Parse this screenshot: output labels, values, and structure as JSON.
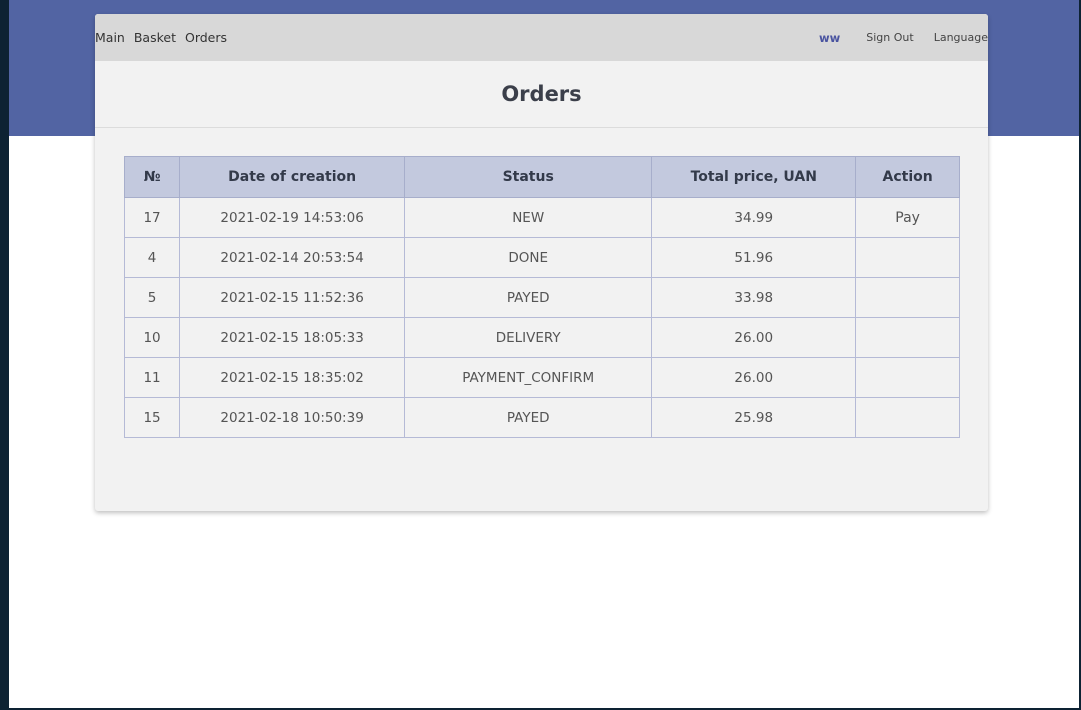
{
  "nav": {
    "main": "Main",
    "basket": "Basket",
    "orders": "Orders",
    "user": "ww",
    "sign_out": "Sign Out",
    "language": "Language"
  },
  "page_title": "Orders",
  "table": {
    "headers": [
      "№",
      "Date of creation",
      "Status",
      "Total price, UAN",
      "Action"
    ],
    "rows": [
      {
        "id": "17",
        "date": "2021-02-19 14:53:06",
        "status": "NEW",
        "price": "34.99",
        "action": "Pay"
      },
      {
        "id": "4",
        "date": "2021-02-14 20:53:54",
        "status": "DONE",
        "price": "51.96",
        "action": ""
      },
      {
        "id": "5",
        "date": "2021-02-15 11:52:36",
        "status": "PAYED",
        "price": "33.98",
        "action": ""
      },
      {
        "id": "10",
        "date": "2021-02-15 18:05:33",
        "status": "DELIVERY",
        "price": "26.00",
        "action": ""
      },
      {
        "id": "11",
        "date": "2021-02-15 18:35:02",
        "status": "PAYMENT_CONFIRM",
        "price": "26.00",
        "action": ""
      },
      {
        "id": "15",
        "date": "2021-02-18 10:50:39",
        "status": "PAYED",
        "price": "25.98",
        "action": ""
      }
    ]
  },
  "colors": {
    "hero": "#5264a3",
    "header_row": "#c3c9de",
    "user_accent": "#4a54a0"
  }
}
